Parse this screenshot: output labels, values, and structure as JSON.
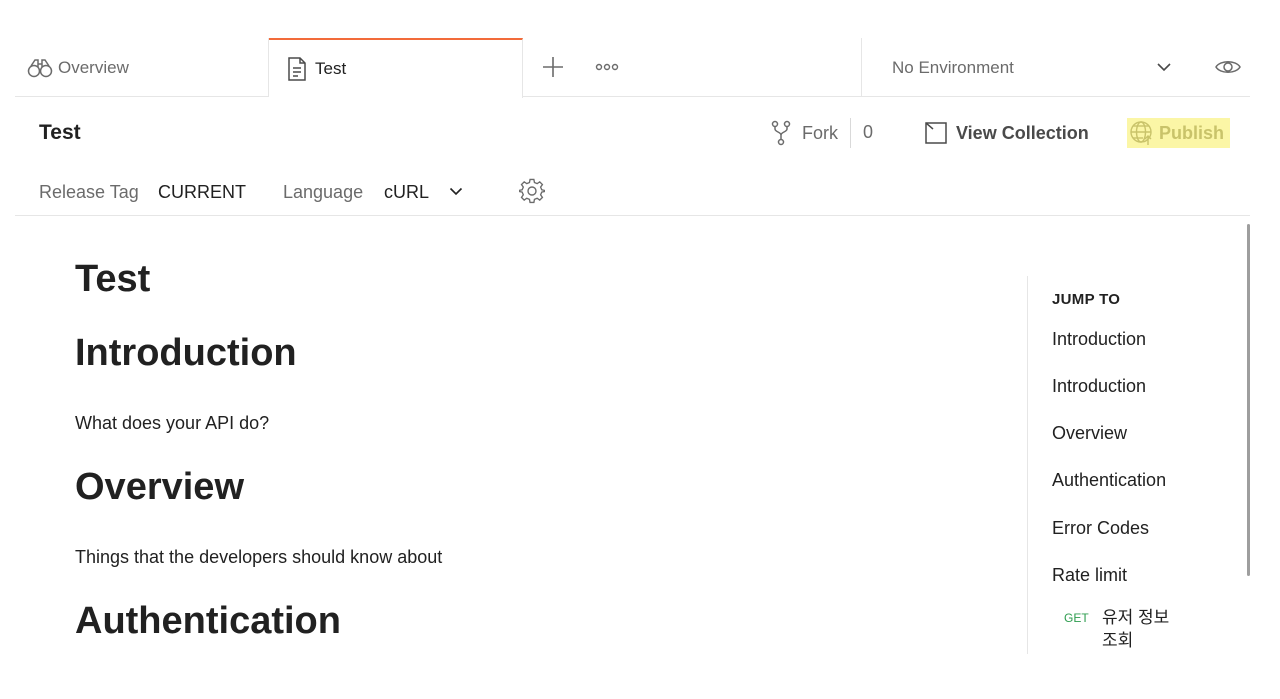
{
  "tabs": [
    {
      "label": "Overview",
      "icon": "binoculars-icon"
    },
    {
      "label": "Test",
      "icon": "document-icon",
      "active": true
    }
  ],
  "environment": {
    "selected": "No Environment"
  },
  "header": {
    "title": "Test",
    "fork_label": "Fork",
    "fork_count": "0",
    "view_collection_label": "View Collection",
    "publish_label": "Publish"
  },
  "subheader": {
    "release_tag_label": "Release Tag",
    "release_tag_value": "CURRENT",
    "language_label": "Language",
    "language_value": "cURL"
  },
  "doc": {
    "title": "Test",
    "sections": [
      {
        "heading": "Introduction",
        "body": "What does your API do?"
      },
      {
        "heading": "Overview",
        "body": "Things that the developers should know about"
      },
      {
        "heading": "Authentication",
        "body": ""
      }
    ]
  },
  "jump_to": {
    "title": "JUMP TO",
    "items": [
      "Introduction",
      "Introduction",
      "Overview",
      "Authentication",
      "Error Codes",
      "Rate limit"
    ],
    "request": {
      "method": "GET",
      "name": "유저 정보 조회"
    }
  },
  "colors": {
    "active_tab_accent": "#f26b3a",
    "publish_highlight": "#fbf6a6",
    "get_method": "#2e9d4f"
  }
}
